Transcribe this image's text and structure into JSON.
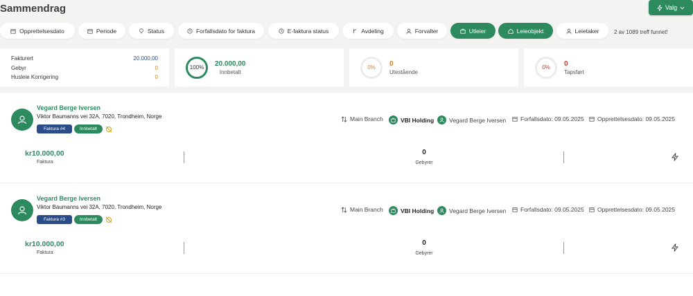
{
  "header": {
    "title": "Sammendrag",
    "valg_label": "Valg"
  },
  "filters": [
    {
      "label": "Opprettelsesdato",
      "icon": "calendar-icon",
      "active": false
    },
    {
      "label": "Periode",
      "icon": "calendar-icon",
      "active": false
    },
    {
      "label": "Status",
      "icon": "status-icon",
      "active": false
    },
    {
      "label": "Forfallsdato for faktura",
      "icon": "clock-icon",
      "active": false
    },
    {
      "label": "E-faktura status",
      "icon": "clock-icon",
      "active": false
    },
    {
      "label": "Avdeling",
      "icon": "branch-icon",
      "active": false
    },
    {
      "label": "Forvalter",
      "icon": "user-icon",
      "active": false
    },
    {
      "label": "Utleier",
      "icon": "briefcase-icon",
      "active": true
    },
    {
      "label": "Leieobjekt",
      "icon": "home-icon",
      "active": true
    },
    {
      "label": "Leietaker",
      "icon": "user-icon",
      "active": false
    }
  ],
  "hits": "2 av 1089 treff funnet!",
  "summary": {
    "rows": [
      {
        "label": "Fakturert",
        "value": "20.000,00",
        "color": "#2a4d8a"
      },
      {
        "label": "Gebyr",
        "value": "0",
        "color": "#d4801e"
      },
      {
        "label": "Husleie Korrigering",
        "value": "0",
        "color": "#d4801e"
      }
    ]
  },
  "stats": [
    {
      "percent": "100%",
      "value": "20.000,00",
      "label": "Innbetalt",
      "color": "#2d8a5f",
      "fill": 1.0
    },
    {
      "percent": "0%",
      "value": "0",
      "label": "Utestående",
      "color": "#d4801e",
      "fill": 0.0
    },
    {
      "percent": "0%",
      "value": "0",
      "label": "Tapsført",
      "color": "#c0392b",
      "fill": 0.0
    }
  ],
  "invoices": [
    {
      "name": "Vegard Berge Iversen",
      "address": "Viktor Baumanns vei 32A, 7020, Trondheim, Norge",
      "invoice_badge": "Faktura #4",
      "status_badge": "Innbetalt",
      "branch": "Main Branch",
      "company": "VBI Holding",
      "person": "Vegard Berge Iversen",
      "due": "Forfallsdato: 09.05.2025",
      "created": "Opprettelsesdato: 09.05.2025",
      "amount": "kr10.000,00",
      "amount_label": "Faktura",
      "fee": "0",
      "fee_label": "Gebyrer"
    },
    {
      "name": "Vegard Berge Iversen",
      "address": "Viktor Baumanns vei 32A, 7020, Trondheim, Norge",
      "invoice_badge": "Faktura #3",
      "status_badge": "Innbetalt",
      "branch": "Main Branch",
      "company": "VBI Holding",
      "person": "Vegard Berge Iversen",
      "due": "Forfallsdato: 09.05.2025",
      "created": "Opprettelsesdato: 09.05.2025",
      "amount": "kr10.000,00",
      "amount_label": "Faktura",
      "fee": "0",
      "fee_label": "Gebyrer"
    }
  ]
}
